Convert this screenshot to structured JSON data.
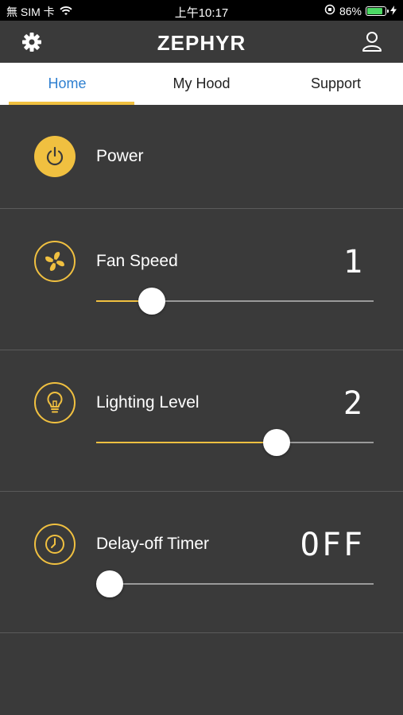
{
  "status_bar": {
    "carrier": "無 SIM 卡",
    "time": "上午10:17",
    "battery_percent": "86%",
    "battery_level": 0.86
  },
  "app": {
    "logo": "ZEPHYR"
  },
  "tabs": [
    {
      "label": "Home",
      "active": true
    },
    {
      "label": "My Hood",
      "active": false
    },
    {
      "label": "Support",
      "active": false
    }
  ],
  "controls": {
    "power": {
      "label": "Power"
    },
    "fan_speed": {
      "label": "Fan Speed",
      "value": "1",
      "slider_fraction": 0.2
    },
    "lighting": {
      "label": "Lighting Level",
      "value": "2",
      "slider_fraction": 0.65
    },
    "timer": {
      "label": "Delay-off Timer",
      "value": "OFF",
      "slider_fraction": 0.05
    }
  },
  "colors": {
    "accent": "#f0c040",
    "active_tab": "#2f80d0",
    "background": "#3a3a3a"
  }
}
